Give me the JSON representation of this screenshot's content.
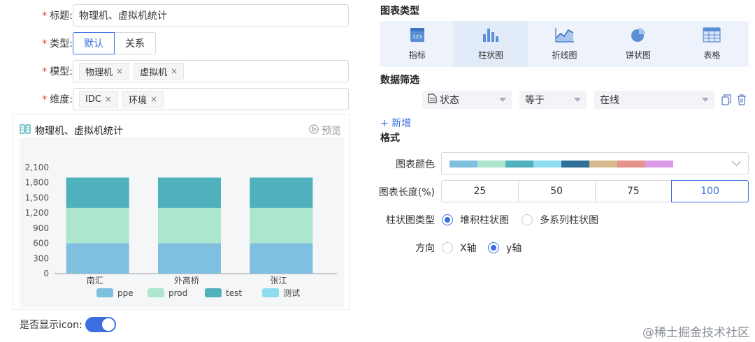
{
  "form": {
    "required_mark": "*",
    "title": {
      "label": "标题:",
      "value": "物理机、虚拟机统计"
    },
    "type": {
      "label": "类型:",
      "options": [
        "默认",
        "关系"
      ],
      "selected": "默认"
    },
    "model": {
      "label": "模型:",
      "tags": [
        "物理机",
        "虚拟机"
      ]
    },
    "dimension": {
      "label": "维度:",
      "tags": [
        "IDC",
        "环境"
      ]
    }
  },
  "tag_close": "×",
  "card": {
    "title": "物理机、虚拟机统计",
    "preview": "预览"
  },
  "chart_data": {
    "type": "bar",
    "stacked": true,
    "categories": [
      "南汇",
      "外高桥",
      "张江"
    ],
    "series": [
      {
        "name": "ppe",
        "values": [
          600,
          600,
          600
        ],
        "color": "#7fbfdf"
      },
      {
        "name": "prod",
        "values": [
          700,
          700,
          700
        ],
        "color": "#ade6cf"
      },
      {
        "name": "test",
        "values": [
          600,
          600,
          600
        ],
        "color": "#4fb1bb"
      },
      {
        "name": "测试",
        "values": [
          0,
          0,
          0
        ],
        "color": "#8fdcef"
      }
    ],
    "y_ticks": [
      "0",
      "300",
      "600",
      "900",
      "1,200",
      "1,500",
      "1,800",
      "2,100"
    ],
    "ylim": [
      0,
      2100
    ],
    "legend_position": "bottom"
  },
  "icon_toggle": {
    "label": "是否显示icon:",
    "on": true
  },
  "right": {
    "chart_type_title": "图表类型",
    "chart_types": [
      {
        "label": "指标",
        "icon": "indicator-icon"
      },
      {
        "label": "柱状图",
        "icon": "bar-chart-icon"
      },
      {
        "label": "折线图",
        "icon": "line-chart-icon"
      },
      {
        "label": "饼状图",
        "icon": "pie-chart-icon"
      },
      {
        "label": "表格",
        "icon": "table-icon"
      }
    ],
    "chart_type_selected": "柱状图",
    "indicator_icon_text": "123",
    "filter_title": "数据筛选",
    "filter": {
      "field": "状态",
      "operator": "等于",
      "value": "在线"
    },
    "add_label": "+ 新增",
    "format_title": "格式",
    "color_label": "图表颜色",
    "palette": [
      "#7fbfdf",
      "#ade6cf",
      "#4fb1bb",
      "#8fdcef",
      "#2f6f99",
      "#d6b98c",
      "#e4938c",
      "#d99be6"
    ],
    "length_label": "图表长度(%)",
    "length_options": [
      "25",
      "50",
      "75",
      "100"
    ],
    "length_selected": "100",
    "bar_type_label": "柱状图类型",
    "bar_type_options": [
      "堆积柱状图",
      "多系列柱状图"
    ],
    "bar_type_selected": "堆积柱状图",
    "direction_label": "方向",
    "direction_options": [
      "X轴",
      "y轴"
    ],
    "direction_selected": "y轴"
  },
  "watermark": "@稀土掘金技术社区",
  "colors": {
    "accent": "#3b6fe0",
    "required": "#e4393c"
  }
}
